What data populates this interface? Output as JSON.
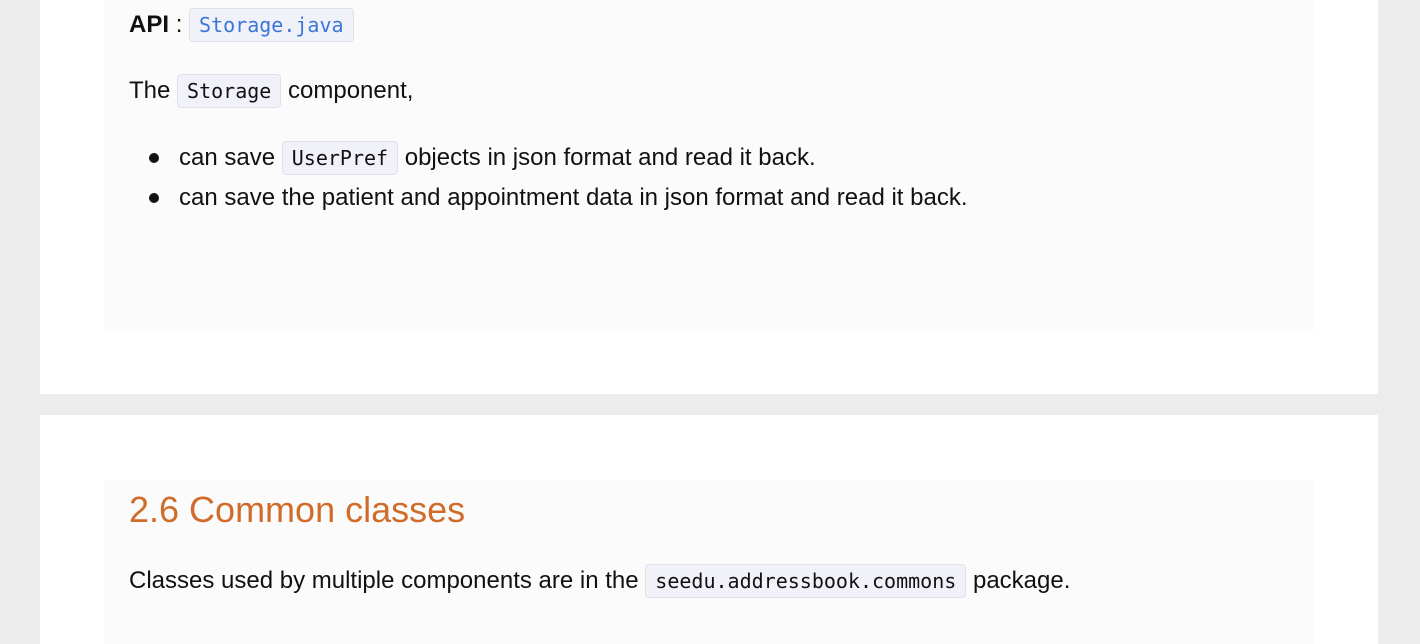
{
  "storage_section": {
    "api_label": "API",
    "api_colon": ":",
    "api_link": "Storage.java",
    "intro_prefix": "The",
    "intro_code": "Storage",
    "intro_suffix": "component,",
    "bullets": [
      {
        "prefix": "can save",
        "code": "UserPref",
        "suffix": "objects in json format and read it back."
      },
      {
        "text": "can save the patient and appointment data in json format and read it back."
      }
    ]
  },
  "common_section": {
    "heading": "2.6 Common classes",
    "text_prefix": "Classes used by multiple components are in the",
    "text_code": "seedu.addressbook.commons",
    "text_suffix": "package."
  },
  "colors": {
    "heading": "#d06b2a",
    "link": "#3a76d8",
    "page_background": "#ececec"
  }
}
